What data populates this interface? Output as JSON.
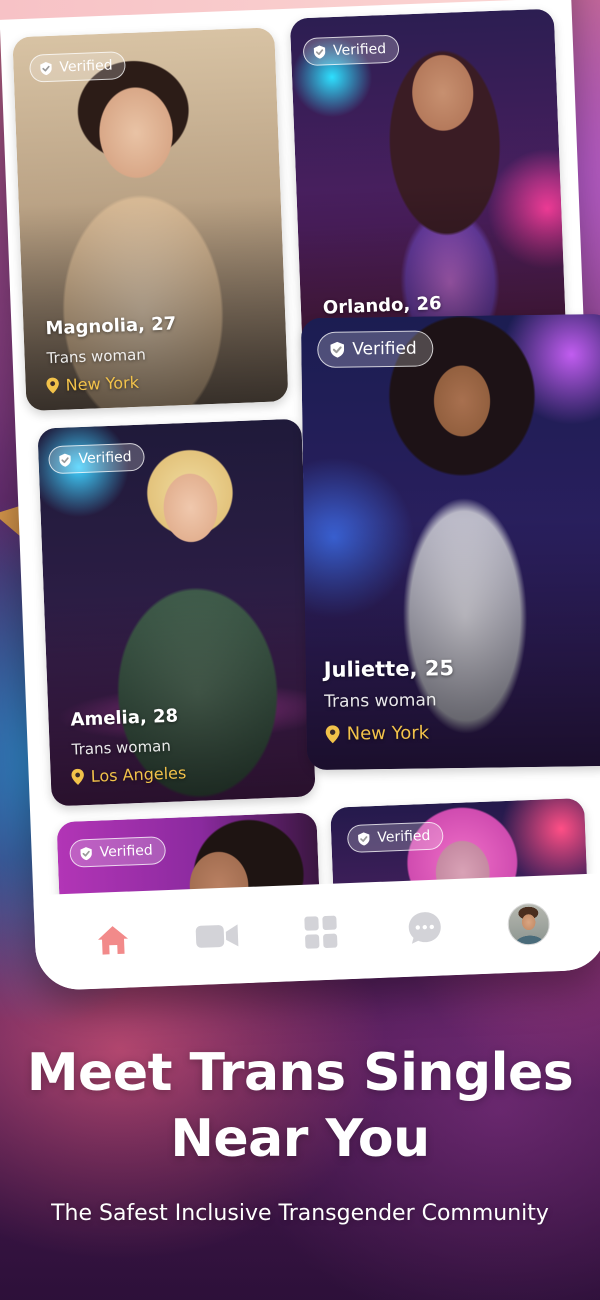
{
  "profiles": [
    {
      "name": "Magnolia, 27",
      "identity": "Trans woman",
      "location": "New York",
      "badge": "Verified"
    },
    {
      "name": "Orlando, 26",
      "badge": "Verified"
    },
    {
      "name": "Amelia, 28",
      "identity": "Trans woman",
      "location": "Los Angeles",
      "badge": "Verified"
    },
    {
      "name": "Juliette, 25",
      "identity": "Trans woman",
      "location": "New York",
      "badge": "Verified"
    },
    {
      "badge": "Verified"
    },
    {
      "badge": "Verified"
    }
  ],
  "nav": {
    "items": [
      {
        "icon": "home-icon",
        "active": true
      },
      {
        "icon": "video-camera-icon",
        "active": false
      },
      {
        "icon": "grid-icon",
        "active": false
      },
      {
        "icon": "chat-bubble-icon",
        "active": false
      },
      {
        "icon": "profile-avatar",
        "active": false
      }
    ]
  },
  "promo": {
    "headline_line1": "Meet Trans Singles",
    "headline_line2": "Near You",
    "subtitle": "The Safest Inclusive Transgender Community"
  },
  "colors": {
    "accent": "#f28a8a",
    "location": "#f2c24a",
    "nav_inactive": "#d3d3d8"
  }
}
